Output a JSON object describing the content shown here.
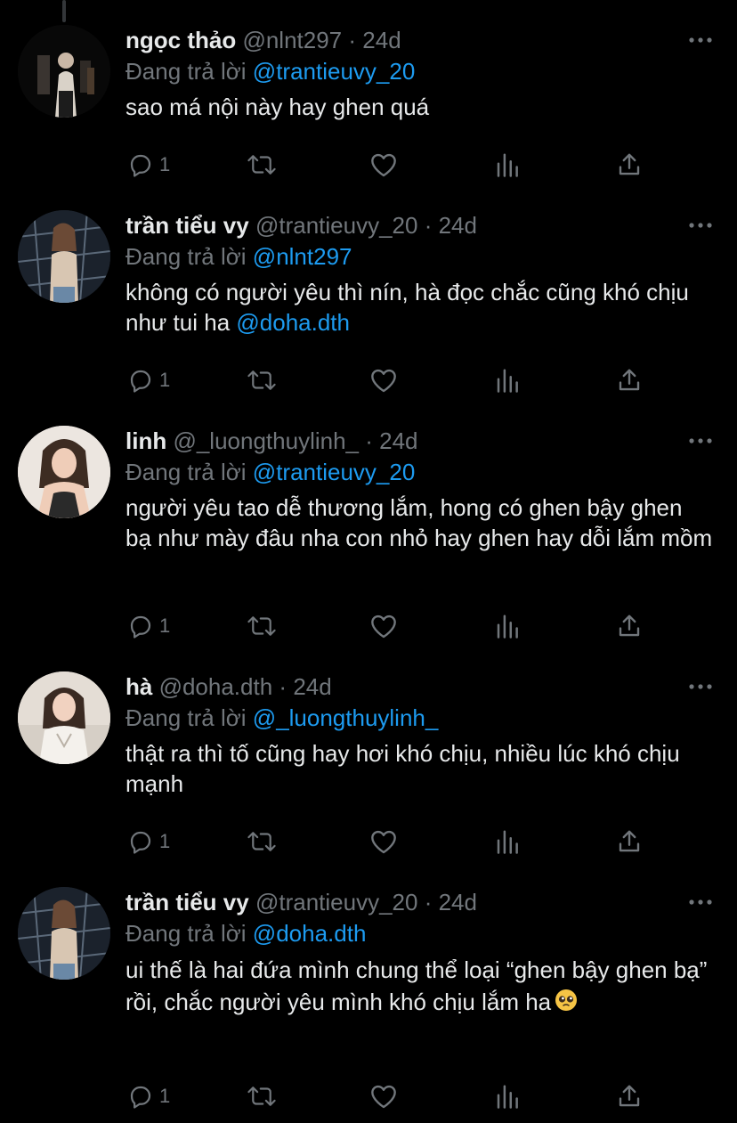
{
  "reply_prefix": "Đang trả lời",
  "tweets": [
    {
      "name": "ngọc thảo",
      "handle": "@nlnt297",
      "separator": "·",
      "time": "24d",
      "reply_to": "@trantieuvy_20",
      "text": "sao má nội này hay ghen quá",
      "reply_count": "1"
    },
    {
      "name": "trần tiểu vy",
      "handle": "@trantieuvy_20",
      "separator": "·",
      "time": "24d",
      "reply_to": "@nlnt297",
      "text_before": "không có người yêu thì nín, hà đọc chắc cũng khó chịu như tui ha ",
      "text_mention": "@doha.dth",
      "reply_count": "1"
    },
    {
      "name": "linh",
      "handle": "@_luongthuylinh_",
      "separator": "·",
      "time": "24d",
      "reply_to": "@trantieuvy_20",
      "text": "người yêu tao dễ thương lắm, hong có ghen bậy ghen bạ như mày đâu nha con nhỏ hay ghen hay dỗi lắm mồm",
      "reply_count": "1"
    },
    {
      "name": "hà",
      "handle": "@doha.dth",
      "separator": "·",
      "time": "24d",
      "reply_to": "@_luongthuylinh_",
      "text": "thật ra thì tố cũng hay hơi khó chịu, nhiều lúc khó chịu mạnh",
      "reply_count": "1"
    },
    {
      "name": "trần tiểu vy",
      "handle": "@trantieuvy_20",
      "separator": "·",
      "time": "24d",
      "reply_to": "@doha.dth",
      "text": "ui thế là hai đứa mình chung thể loại “ghen bậy ghen bạ” rồi, chắc người yêu mình khó chịu lắm ha",
      "emoji": "pleading-face-emoji",
      "reply_count": "1"
    }
  ],
  "icons": {
    "reply": "reply-icon",
    "retweet": "retweet-icon",
    "like": "like-icon",
    "views": "views-icon",
    "share": "share-icon",
    "more": "more-icon"
  },
  "colors": {
    "background": "#000000",
    "text": "#e7e9ea",
    "secondary": "#71767b",
    "mention": "#1d9bf0",
    "thread_line": "#333639"
  }
}
